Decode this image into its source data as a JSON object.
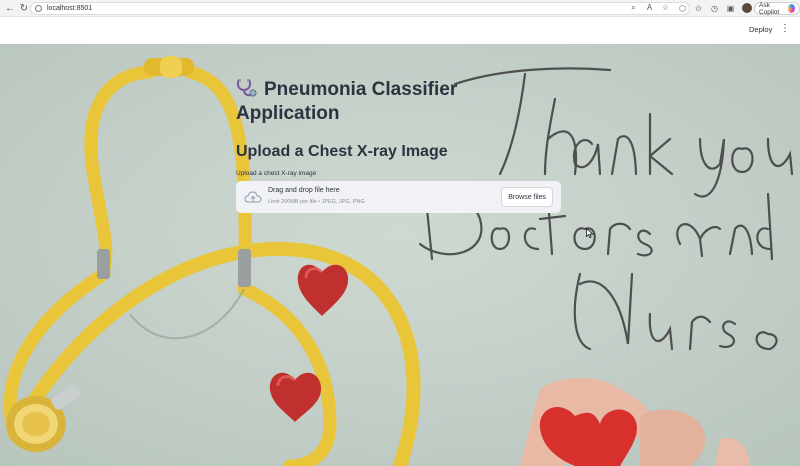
{
  "browser": {
    "url": "localhost:8501",
    "copilot_label": "Ask Copilot"
  },
  "header": {
    "deploy_label": "Deploy"
  },
  "background": {
    "handwriting_lines": [
      "Thank you",
      "Doctors and",
      "Nurses"
    ]
  },
  "main": {
    "title": "Pneumonia Classifier Application",
    "subtitle": "Upload a Chest X-ray Image",
    "uploader": {
      "label": "Upload a chest X-ray image",
      "drag_text": "Drag and drop file here",
      "limit_text": "Limit 200MB per file • JPEG, JPG, PNG",
      "button_label": "Browse files"
    }
  },
  "colors": {
    "background_tint": "#c4d0c8",
    "stethoscope_yellow": "#e9c53a",
    "heart_red": "#c0302e",
    "text": "#31333f"
  }
}
